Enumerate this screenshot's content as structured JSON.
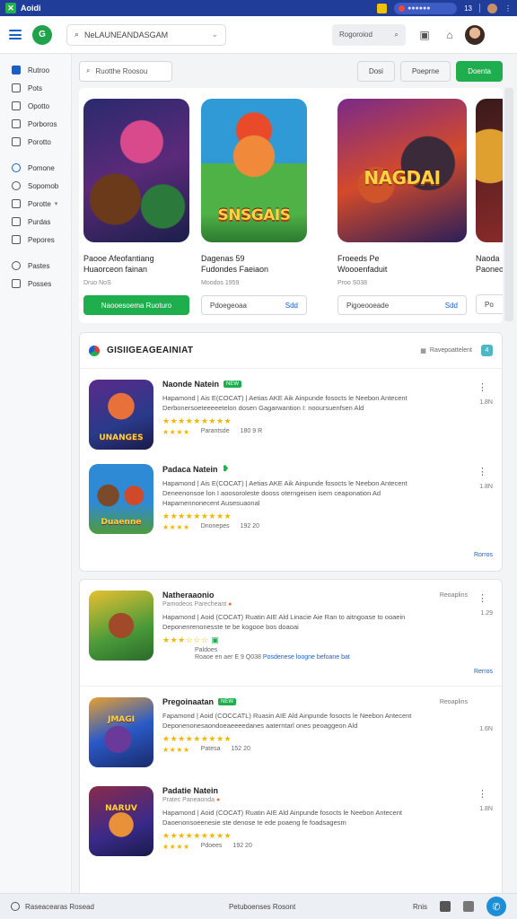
{
  "statusbar": {
    "title": "Aoidi",
    "count": "13"
  },
  "header": {
    "search_text": "NeLAUNEANDASGAM",
    "search_right_placeholder": "Rogoroiod"
  },
  "sidebar": {
    "items": [
      {
        "label": "Rutroo",
        "icon": "home-icon"
      },
      {
        "label": "Pots",
        "icon": "grid-icon"
      },
      {
        "label": "Opotto",
        "icon": "box-icon"
      },
      {
        "label": "Porboros",
        "icon": "box-icon"
      },
      {
        "label": "Porotto",
        "icon": "list-icon"
      },
      {
        "label": "Pomone",
        "icon": "share-icon"
      },
      {
        "label": "Sopomob",
        "icon": "clock-icon"
      },
      {
        "label": "Porotte",
        "icon": "folder-icon"
      },
      {
        "label": "Purdas",
        "icon": "box-icon"
      },
      {
        "label": "Pepores",
        "icon": "pen-icon"
      },
      {
        "label": "Pastes",
        "icon": "help-icon"
      },
      {
        "label": "Posses",
        "icon": "info-icon"
      }
    ]
  },
  "filters": {
    "search_placeholder": "Ruotthe Roosou",
    "btn1": "Dosi",
    "btn2": "Poeprne",
    "btn3": "Doenta"
  },
  "featured": [
    {
      "title_line1": "Paooe Afeofantiang",
      "title_line2": "Huaorceon fainan",
      "sub": "Druo NoS",
      "button": "Naooesoema Ruoturo",
      "art_label": ""
    },
    {
      "title_line1": "Dagenas  59",
      "title_line2": "Fudondes Faeiaon",
      "sub": "Moodos 1959",
      "button": "Pdoegeoaa",
      "button_extra": "Sdd",
      "art_label": "SNSGAIS"
    },
    {
      "title_line1": "Froeeds  Pe",
      "title_line2": "Woooenfaduit",
      "sub": "Proo  S038",
      "button": "Pigoeooeade",
      "button_extra": "Sdd",
      "art_label": "NAGDAI"
    },
    {
      "title_line1": "Naoda",
      "title_line2": "Paoneo",
      "sub": "",
      "button": "Po",
      "art_label": ""
    }
  ],
  "section": {
    "title": "GISIIGEAGEAINIAT",
    "sort_label": "Ravepoattelent",
    "badge": "4"
  },
  "rows_top": [
    {
      "title": "Naonde Natein",
      "tag": "NEW",
      "desc1": "Hapamond | Ais E(COCAT) | Aetias AKE Aik Ainpunde fosocts le Neebon Antecent",
      "desc2": "Derbonersoeteeeeetelon dosen Gagarwantion I: nooursuenfsen Ald",
      "meta_date": "Parantsde",
      "meta_ver": "180 9 R",
      "size": "1.8N",
      "art_label": "UNANGES"
    },
    {
      "title": "Padaca Natein",
      "tag": "",
      "desc1": "Hapamond | Ais E(COCAT) | Aetias AKE Aik Ainpunde fosocts le Neebon Antecent",
      "desc2": "Deneenonsoe lon I aoosoroleste dooss oterngeisen isem ceaponation Ad",
      "desc3": "Hapamennonecent Ausesuaonal",
      "meta_date": "Dnonepes",
      "meta_ver": "192 20",
      "size": "1.8N",
      "art_label": "Duaenne"
    }
  ],
  "rows_top_more": "Rorros",
  "rows_bottom": [
    {
      "title": "Natheraaonio",
      "sub": "Pamodeos Parecheant",
      "ctag": "Reoaplins",
      "desc1": "Hapamond | Aoid (COCAT) Ruatin AIE Ald Linacie Aie Ran  to aitngoase to ooaein",
      "desc2": "Deponenrenonesste te be kogooe  bos doaoai",
      "note": "Paldoes",
      "meta_date": "Roaoe en  aer E 9 Q038",
      "meta_link": "Posdenese loogne befoane bat",
      "size": "1.29",
      "art_label": ""
    },
    {
      "title": "Pregoinaatan",
      "tag": "NEW",
      "ctag": "Reoaplins",
      "desc1": "Fapamond | Aoid (COCCATL) Ruasin AIE Ald  Ainpunde fosocts le Neebon Antecent",
      "desc2": "Deponenonesaondoeaeeeedanes aaterntarl ones peoaggeon Ald",
      "meta_date": "Patesa",
      "meta_ver": "152 20",
      "size": "1.6N",
      "art_label": "JMAGI"
    },
    {
      "title": "Padatie Natein",
      "sub": "Pratec Paneaonda",
      "desc1": "Hapamond | Aoid (COCAT) Ruatin AIE Ald Ainpunde fosocts le Neebon Antecent",
      "desc2": "Daoenonsoeenesie ste denose te ede poaeng fe foadsagesm",
      "meta_date": "Pdoees",
      "meta_ver": "192 20",
      "size": "1.8N",
      "art_label": "NARUV"
    }
  ],
  "rows_bottom_more": "Rerros",
  "bottombar": {
    "left": "Raseacearas Rosead",
    "mid": "Petuboenses Rosont",
    "right": "Rnis"
  },
  "colors": {
    "accent": "#1fae4e",
    "brand": "#1f3d99",
    "link": "#1a5fc8",
    "star": "#f2b705"
  }
}
